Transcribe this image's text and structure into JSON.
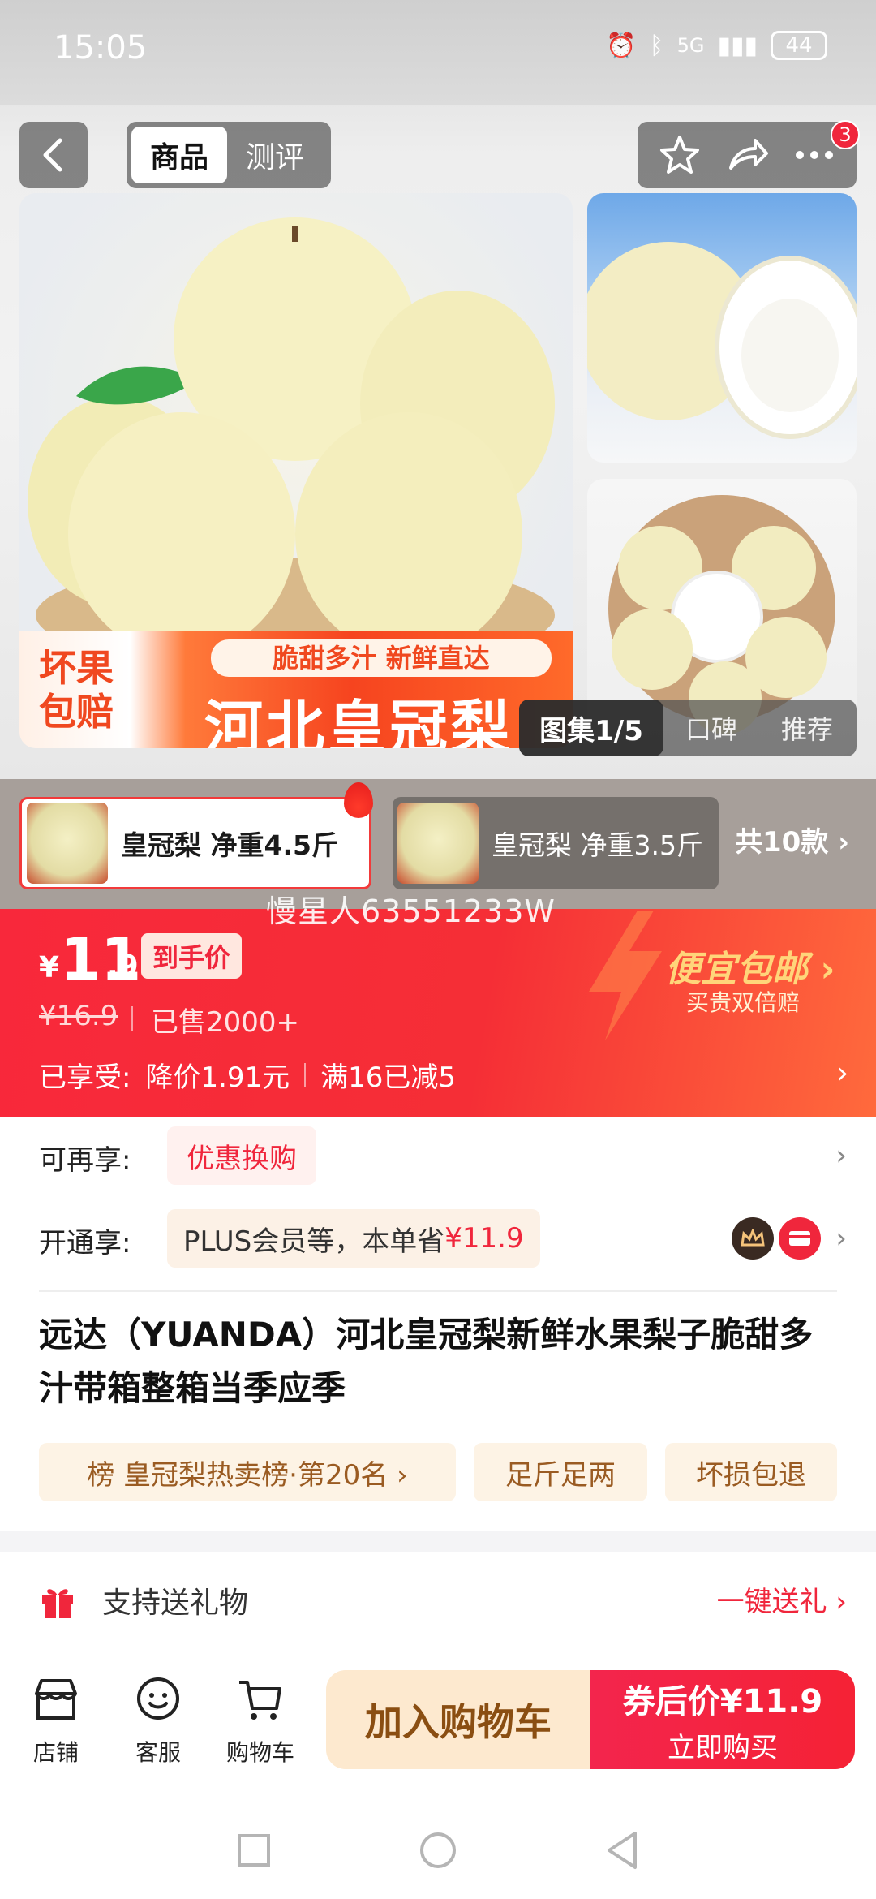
{
  "status_bar": {
    "time": "15:05",
    "network": "5G",
    "battery": "44"
  },
  "nav": {
    "tabs": [
      {
        "label": "商品"
      },
      {
        "label": "测评"
      }
    ],
    "badge": "3"
  },
  "hero": {
    "banner_left": "坏果\n包赔",
    "banner_sub": "脆甜多汁 新鲜直达",
    "banner_title": "河北皇冠梨",
    "gallery_current": "图集1/5",
    "gallery_opt1": "口碑",
    "gallery_opt2": "推荐"
  },
  "variants": {
    "items": [
      {
        "label": "皇冠梨 净重4.5斤",
        "selected": true
      },
      {
        "label": "皇冠梨 净重3.5斤",
        "selected": false
      }
    ],
    "more": "共10款"
  },
  "watermark": "慢星人63551233W",
  "price": {
    "currency": "¥",
    "main": "11",
    "decimal": ".9",
    "tag": "到手价",
    "original": "¥16.9",
    "sold": "已售2000+",
    "enjoyed_label": "已享受:",
    "discount1": "降价1.91元",
    "discount2": "满16已减5",
    "promo_title": "便宜包邮",
    "promo_sub": "买贵双倍赔"
  },
  "benefits": {
    "row1_label": "可再享:",
    "row1_chip": "优惠换购",
    "row2_label": "开通享:",
    "row2_chip_text": "PLUS会员等，本单省",
    "row2_chip_amount": "¥11.9"
  },
  "product": {
    "title": "远达（YUANDA）河北皇冠梨新鲜水果梨子脆甜多汁带箱整箱当季应季",
    "tags": [
      "榜 皇冠梨热卖榜·第20名 ›",
      "足斤足两",
      "坏损包退"
    ]
  },
  "gift": {
    "label": "支持送礼物",
    "action": "一键送礼 ›"
  },
  "bottom": {
    "store": "店铺",
    "service": "客服",
    "cart": "购物车",
    "add_to_cart": "加入购物车",
    "buy_line1": "券后价¥11.9",
    "buy_line2": "立即购买"
  },
  "colors": {
    "accent": "#f0263c",
    "promo": "#ffd57a",
    "cart_bg": "#fde9cf"
  }
}
